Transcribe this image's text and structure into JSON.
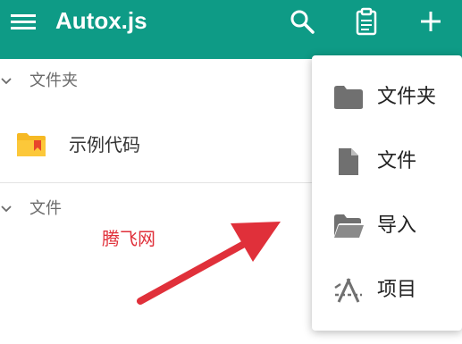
{
  "app": {
    "title": "Autox.js"
  },
  "toolbar": {
    "menu_icon": "menu-icon",
    "search_icon": "search-icon",
    "clipboard_icon": "clipboard-icon",
    "add_icon": "add-icon"
  },
  "sections": {
    "folders_label": "文件夹",
    "files_label": "文件"
  },
  "folder_list": [
    {
      "name": "示例代码",
      "icon": "folder-icon"
    }
  ],
  "watermark": "腾飞网",
  "popup_menu": [
    {
      "label": "文件夹",
      "icon": "folder-icon"
    },
    {
      "label": "文件",
      "icon": "file-icon"
    },
    {
      "label": "导入",
      "icon": "folder-open-icon"
    },
    {
      "label": "项目",
      "icon": "project-icon"
    }
  ],
  "colors": {
    "appbar": "#0e9b86",
    "annotation": "#e0303a"
  }
}
